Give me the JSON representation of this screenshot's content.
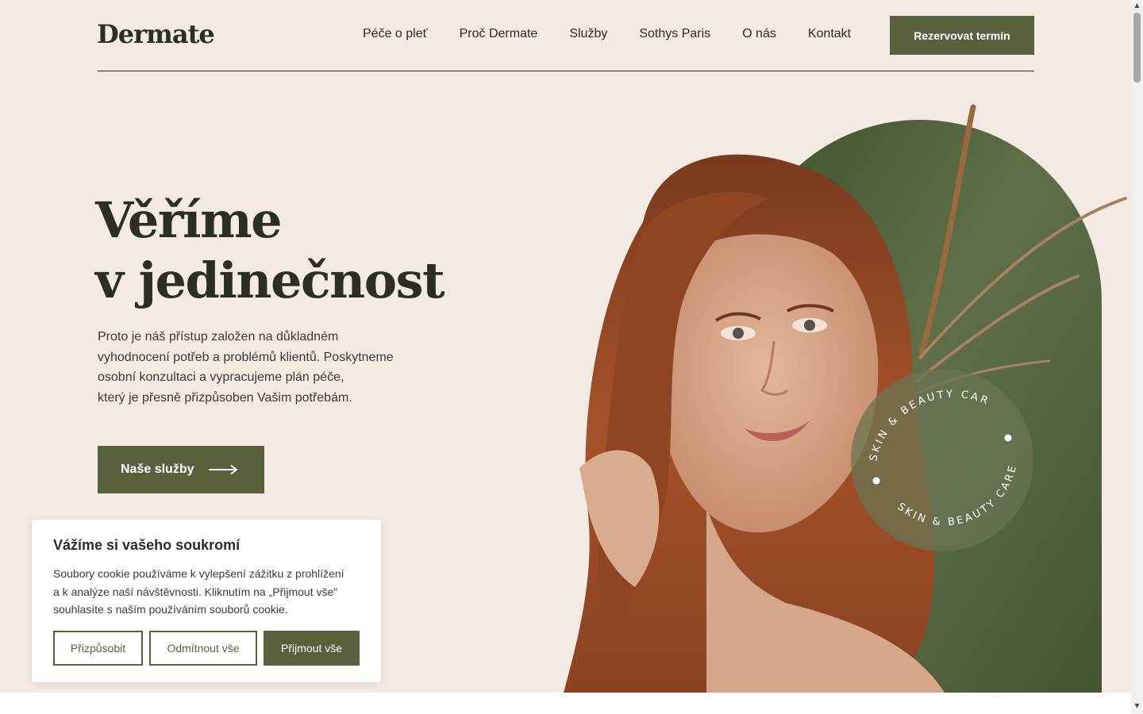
{
  "brand": {
    "logo": "Dermate",
    "colors": {
      "accent": "#59603c",
      "background": "#f3ebe3",
      "arch_green": "#4b5b36",
      "text_dark": "#2b2f22"
    }
  },
  "nav": {
    "items": [
      "Péče o pleť",
      "Proč Dermate",
      "Služby",
      "Sothys Paris",
      "O nás",
      "Kontakt"
    ],
    "cta": "Rezervovat termín"
  },
  "hero": {
    "title_line1": "Věříme",
    "title_line2": "v jedinečnost",
    "text_lines": [
      "Proto je náš přístup založen na důkladném",
      "vyhodnocení potřeb a problémů klientů. Poskytneme",
      "osobní konzultaci a vypracujeme plán péče,",
      "který je přesně přizpůsoben Vašim potřebám."
    ],
    "button": "Naše služby",
    "button_icon": "arrow-right-icon",
    "badge_text": "SKIN & BEAUTY CARE",
    "badge_text_repeat": "SKIN & BEAUTY CARE"
  },
  "cookie": {
    "title": "Vážíme si vašeho soukromí",
    "text_lines": [
      "Soubory cookie používáme k vylepšení zážitku z prohlížení",
      "a k analýze naší návštěvnosti. Kliknutím na „Přijmout vše\"",
      "souhlasíte s naším používáním souborů cookie."
    ],
    "customize": "Přizpůsobit",
    "reject": "Odmítnout vše",
    "accept": "Přijmout vše"
  },
  "scrollbar": {
    "up_icon": "scroll-up-arrow-icon",
    "down_icon": "scroll-down-arrow-icon"
  }
}
